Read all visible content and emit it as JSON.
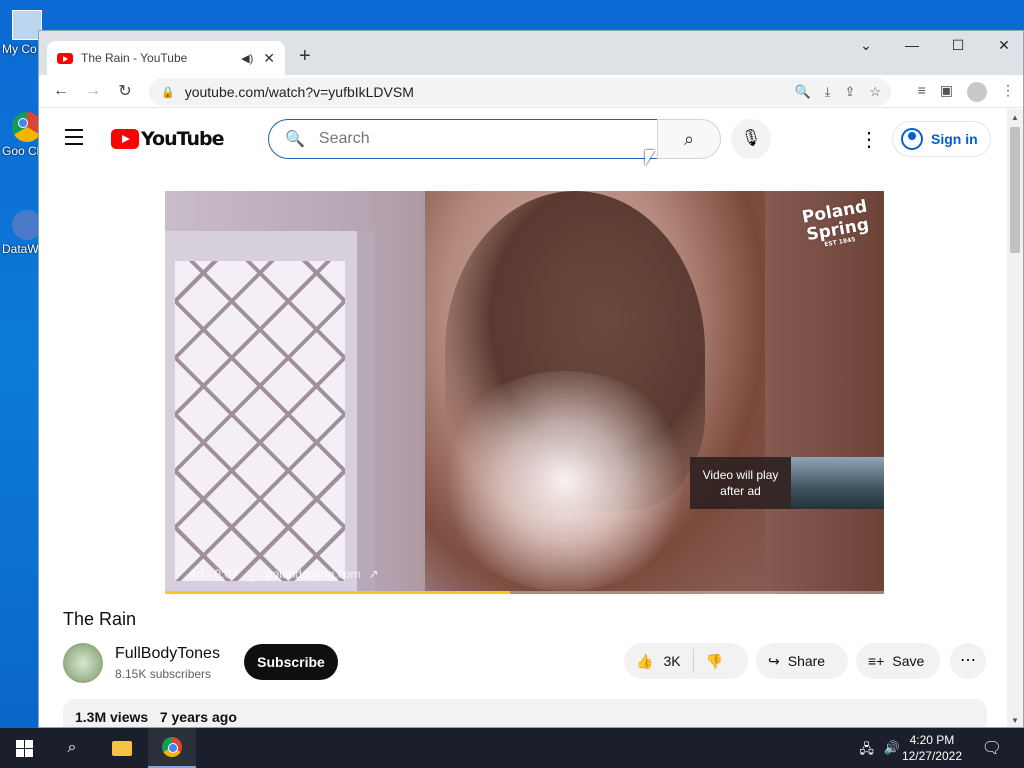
{
  "desktop": {
    "icons": [
      {
        "label": "My Co"
      },
      {
        "label": "Goo Chr"
      },
      {
        "label": "DataW"
      }
    ]
  },
  "browser": {
    "tab_title": "The Rain - YouTube",
    "new_tab": "+",
    "url": "youtube.com/watch?v=yufbIkLDVSM",
    "controls": {
      "minimize": "—",
      "maximize": "☐",
      "close": "✕",
      "dropdown": "⌄"
    }
  },
  "youtube": {
    "logo_text": "YouTube",
    "search_placeholder": "Search",
    "sign_in": "Sign in",
    "video": {
      "brand_line1": "Poland",
      "brand_line2": "Spring",
      "brand_small": "EST 1845",
      "next_label": "Video will play after ad",
      "ad_label": "Ad · 0:07",
      "ad_domain": "polandspring.com",
      "progress": 0.48
    },
    "title": "The Rain",
    "channel": {
      "name": "FullBodyTones",
      "subscribers": "8.15K subscribers",
      "subscribe": "Subscribe"
    },
    "actions": {
      "likes": "3K",
      "share": "Share",
      "save": "Save"
    },
    "description": {
      "views": "1.3M views",
      "age": "7 years ago"
    }
  },
  "taskbar": {
    "time": "4:20 PM",
    "date": "12/27/2022"
  }
}
